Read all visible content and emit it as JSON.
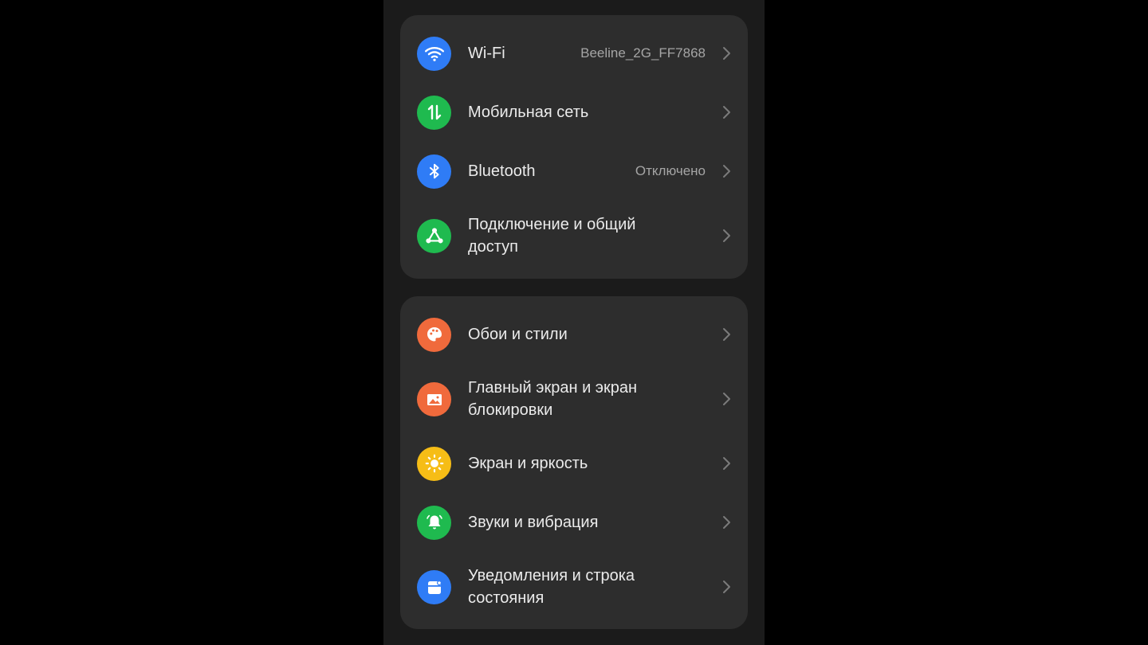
{
  "sections": [
    {
      "items": [
        {
          "label": "Wi-Fi",
          "value": "Beeline_2G_FF7868",
          "icon": "wifi-icon",
          "color": "#2f7cf6"
        },
        {
          "label": "Мобильная сеть",
          "value": "",
          "icon": "mobile-data-icon",
          "color": "#1fba4f"
        },
        {
          "label": "Bluetooth",
          "value": "Отключено",
          "icon": "bluetooth-icon",
          "color": "#2f7cf6"
        },
        {
          "label": "Подключение и общий доступ",
          "value": "",
          "icon": "share-icon",
          "color": "#1fba4f"
        }
      ]
    },
    {
      "items": [
        {
          "label": "Обои и стили",
          "value": "",
          "icon": "palette-icon",
          "color": "#f06a3c"
        },
        {
          "label": "Главный экран и экран блокировки",
          "value": "",
          "icon": "picture-icon",
          "color": "#f06a3c"
        },
        {
          "label": "Экран и яркость",
          "value": "",
          "icon": "sun-icon",
          "color": "#f6bd16"
        },
        {
          "label": "Звуки и вибрация",
          "value": "",
          "icon": "bell-icon",
          "color": "#1fba4f"
        },
        {
          "label": "Уведомления и строка состояния",
          "value": "",
          "icon": "notification-icon",
          "color": "#2f7cf6"
        }
      ]
    }
  ]
}
